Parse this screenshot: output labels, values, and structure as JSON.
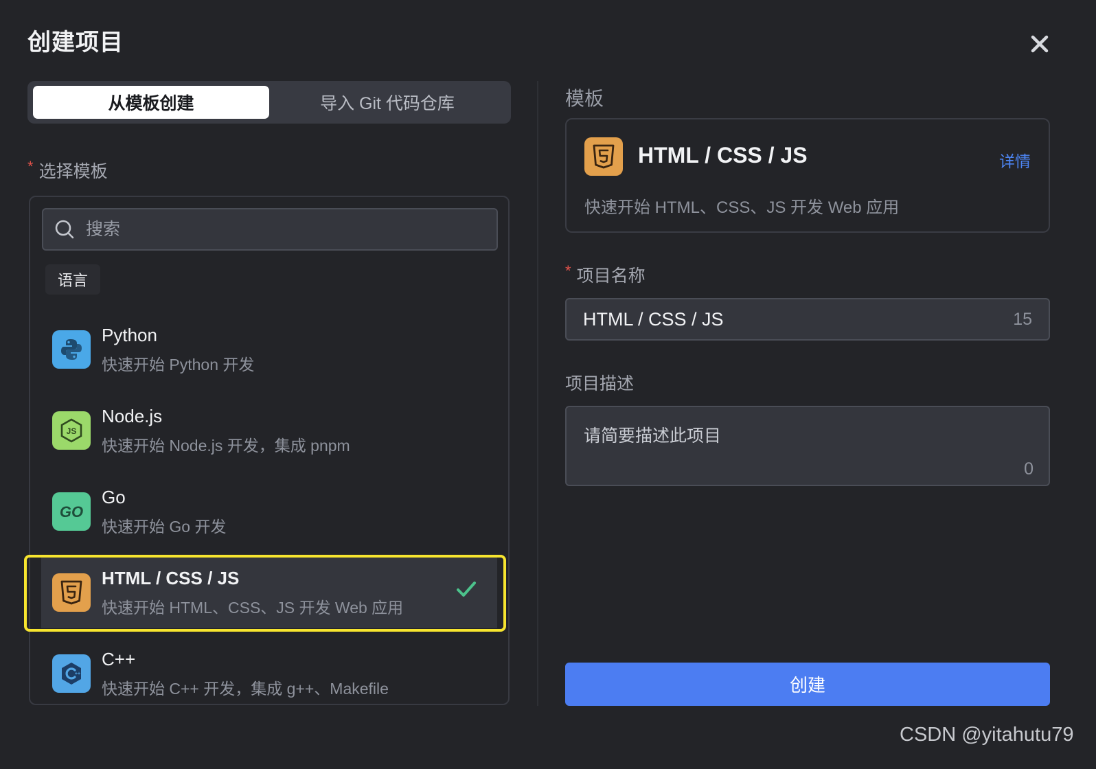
{
  "dialog": {
    "title": "创建项目"
  },
  "modes": [
    {
      "label": "从模板创建",
      "active": true
    },
    {
      "label": "导入 Git 代码仓库",
      "active": false
    }
  ],
  "template_select": {
    "label": "选择模板",
    "search_placeholder": "搜索",
    "category": "语言",
    "items": [
      {
        "name": "Python",
        "desc": "快速开始 Python 开发",
        "icon": "python-icon",
        "color": "#4aa8e8"
      },
      {
        "name": "Node.js",
        "desc": "快速开始 Node.js 开发，集成 pnpm",
        "icon": "nodejs-icon",
        "color": "#9bd96a"
      },
      {
        "name": "Go",
        "desc": "快速开始 Go 开发",
        "icon": "go-icon",
        "color": "#55c995"
      },
      {
        "name": "HTML / CSS / JS",
        "desc": "快速开始 HTML、CSS、JS 开发 Web 应用",
        "icon": "html5-icon",
        "color": "#e3a04c",
        "selected": true
      },
      {
        "name": "C++",
        "desc": "快速开始 C++ 开发，集成 g++、Makefile",
        "icon": "cpp-icon",
        "color": "#52a6e6"
      }
    ]
  },
  "selected_template": {
    "section_label": "模板",
    "name": "HTML / CSS / JS",
    "detail_link": "详情",
    "desc": "快速开始 HTML、CSS、JS 开发 Web 应用"
  },
  "project_name": {
    "label": "项目名称",
    "value": "HTML / CSS / JS",
    "count": "15"
  },
  "project_desc": {
    "label": "项目描述",
    "placeholder": "请简要描述此项目",
    "count": "0"
  },
  "create_button": "创建",
  "watermark": "CSDN @yitahutu79",
  "colors": {
    "accent": "#4c7df2",
    "highlight": "#f7e52f",
    "check": "#4cc28c",
    "required": "#e5534b"
  }
}
